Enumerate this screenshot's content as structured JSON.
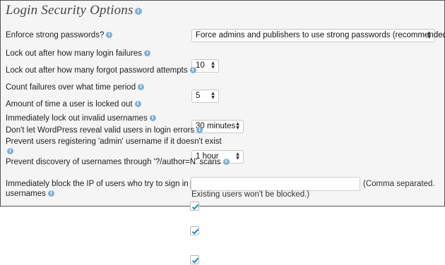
{
  "section": {
    "title": "Login Security Options"
  },
  "fields": [
    {
      "label": "Enforce strong passwords?",
      "type": "select",
      "value": "Force admins and publishers to use strong passwords (recommended)"
    },
    {
      "label": "Lock out after how many login failures",
      "type": "select",
      "value": "10"
    },
    {
      "label": "Lock out after how many forgot password attempts",
      "type": "select",
      "value": "5"
    },
    {
      "label": "Count failures over what time period",
      "type": "select",
      "value": "30 minutes"
    },
    {
      "label": "Amount of time a user is locked out",
      "type": "select",
      "value": "1 hour"
    },
    {
      "label": "Immediately lock out invalid usernames",
      "type": "checkbox",
      "checked": true
    },
    {
      "label": "Don't let WordPress reveal valid users in login errors",
      "type": "checkbox",
      "checked": true
    },
    {
      "label_line1": "Prevent users registering 'admin' username if it doesn't exist",
      "type": "checkbox",
      "checked": true
    },
    {
      "label": "Prevent discovery of usernames through '?/author=N' scans",
      "type": "checkbox",
      "checked": true
    },
    {
      "label_line1": "Immediately block the IP of users who try to sign in as these",
      "label_line2": "usernames",
      "type": "text",
      "value": "",
      "help_line1": "(Comma separated.",
      "help_line2": "Existing users won't be blocked.)"
    }
  ],
  "icons": {
    "info": "info-icon",
    "select_arrows": "select-arrows-icon",
    "checkmark": "checkmark-icon"
  },
  "colors": {
    "panel_bg": "#f5f5f5",
    "info_icon": "#7fb0d6",
    "checkmark": "#1e8cbe",
    "title": "#464646"
  }
}
